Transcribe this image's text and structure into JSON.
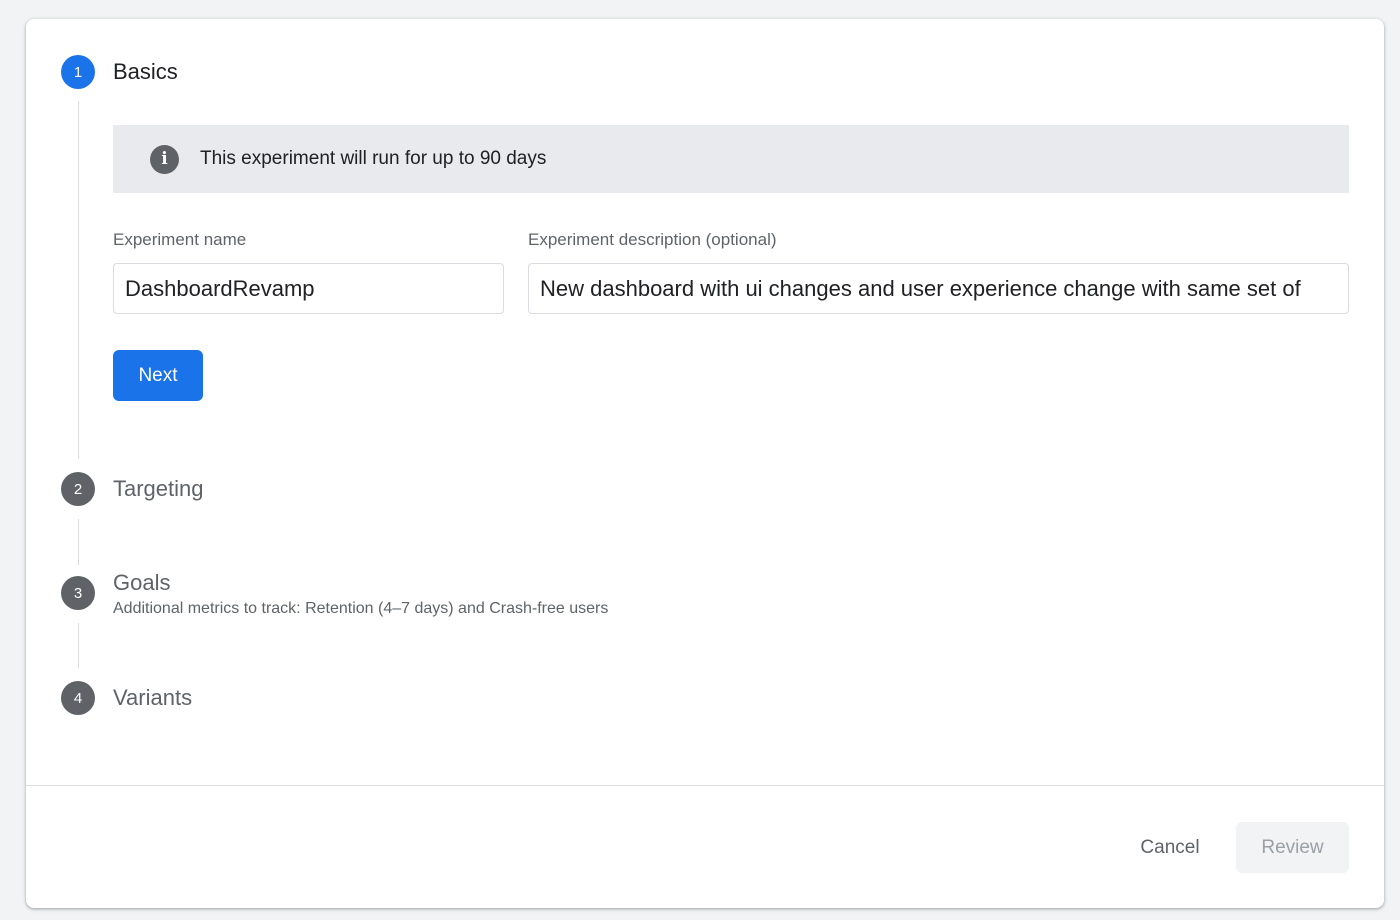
{
  "steps": [
    {
      "number": "1",
      "title": "Basics",
      "state": "active"
    },
    {
      "number": "2",
      "title": "Targeting",
      "state": "inactive"
    },
    {
      "number": "3",
      "title": "Goals",
      "subtitle": "Additional metrics to track: Retention (4–7 days) and Crash-free users",
      "state": "inactive"
    },
    {
      "number": "4",
      "title": "Variants",
      "state": "inactive"
    }
  ],
  "info_banner": {
    "icon": "info-icon",
    "text": "This experiment will run for up to 90 days"
  },
  "form": {
    "name_label": "Experiment name",
    "name_value": "DashboardRevamp",
    "description_label": "Experiment description (optional)",
    "description_value": "New dashboard with ui changes and user experience change with same set of",
    "next_label": "Next"
  },
  "footer": {
    "cancel_label": "Cancel",
    "review_label": "Review"
  },
  "colors": {
    "accent": "#1a73e8",
    "inactive_step": "#5f6368",
    "banner_bg": "#e8eaed"
  }
}
